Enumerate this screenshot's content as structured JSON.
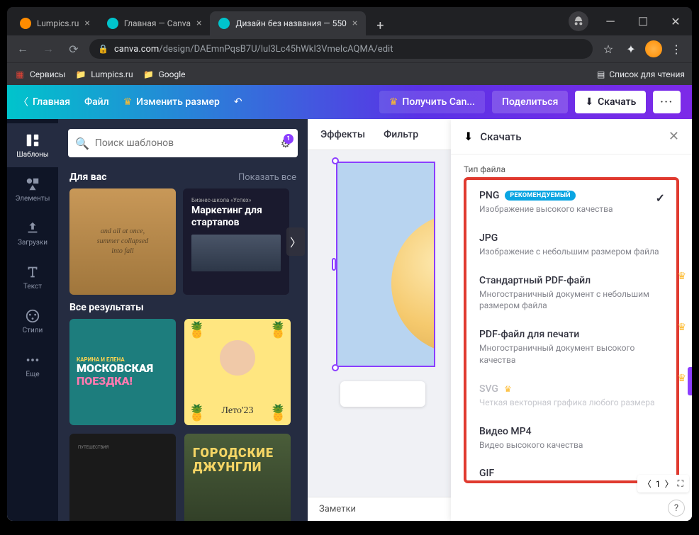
{
  "browser": {
    "tabs": [
      {
        "title": "Lumpics.ru",
        "favicon": "#ff8c00"
      },
      {
        "title": "Главная — Canva",
        "favicon": "#00c4cc"
      },
      {
        "title": "Дизайн без названия — 550",
        "favicon": "#00c4cc",
        "active": true
      }
    ],
    "url_domain": "canva.com",
    "url_path": "/design/DAEmnPqsB7U/lul3Lc45hWkI3VmeIcAQMA/edit",
    "bookmarks": {
      "services": "Сервисы",
      "lumpics": "Lumpics.ru",
      "google": "Google",
      "reading_list": "Список для чтения"
    }
  },
  "header": {
    "home": "Главная",
    "file": "Файл",
    "resize": "Изменить размер",
    "get_canva": "Получить Can...",
    "share": "Поделиться",
    "download": "Скачать"
  },
  "sidenav": {
    "templates": "Шаблоны",
    "elements": "Элементы",
    "uploads": "Загрузки",
    "text": "Текст",
    "styles": "Стили",
    "more": "Еще"
  },
  "panel": {
    "search_placeholder": "Поиск шаблонов",
    "filter_count": "1",
    "for_you": "Для вас",
    "show_all": "Показать все",
    "all_results": "Все результаты",
    "card_fall": "and all at once,\nsummer collapsed\ninto fall",
    "card_marketing_sm": "Бизнес-школа «Успех»",
    "card_marketing_big": "Маркетинг для стартапов",
    "card_moscow_top": "КАРИНА И ЕЛЕНА",
    "card_moscow_1": "МОСКОВСКАЯ",
    "card_moscow_2": "ПОЕЗДКА!",
    "card_summer": "Лето'23",
    "card_jungle_1": "ГОРОДСКИЕ",
    "card_jungle_2": "ДЖУНГЛИ"
  },
  "canvas": {
    "effects": "Эффекты",
    "filters": "Фильтр",
    "notes": "Заметки",
    "page": "1"
  },
  "download_panel": {
    "title": "Скачать",
    "file_type_label": "Тип файла",
    "options": [
      {
        "name": "PNG",
        "badge": "РЕКОМЕНДУЕМЫЙ",
        "desc": "Изображение высокого качества",
        "selected": true
      },
      {
        "name": "JPG",
        "desc": "Изображение с небольшим размером файла"
      },
      {
        "name": "Стандартный PDF-файл",
        "desc": "Многостраничный документ с небольшим размером файла"
      },
      {
        "name": "PDF-файл для печати",
        "desc": "Многостраничный документ высокого качества"
      },
      {
        "name": "SVG",
        "premium": true,
        "disabled": true,
        "desc": "Четкая векторная графика любого размера"
      },
      {
        "name": "Видео MP4",
        "desc": "Видео высокого качества"
      },
      {
        "name": "GIF",
        "desc": ""
      }
    ]
  }
}
